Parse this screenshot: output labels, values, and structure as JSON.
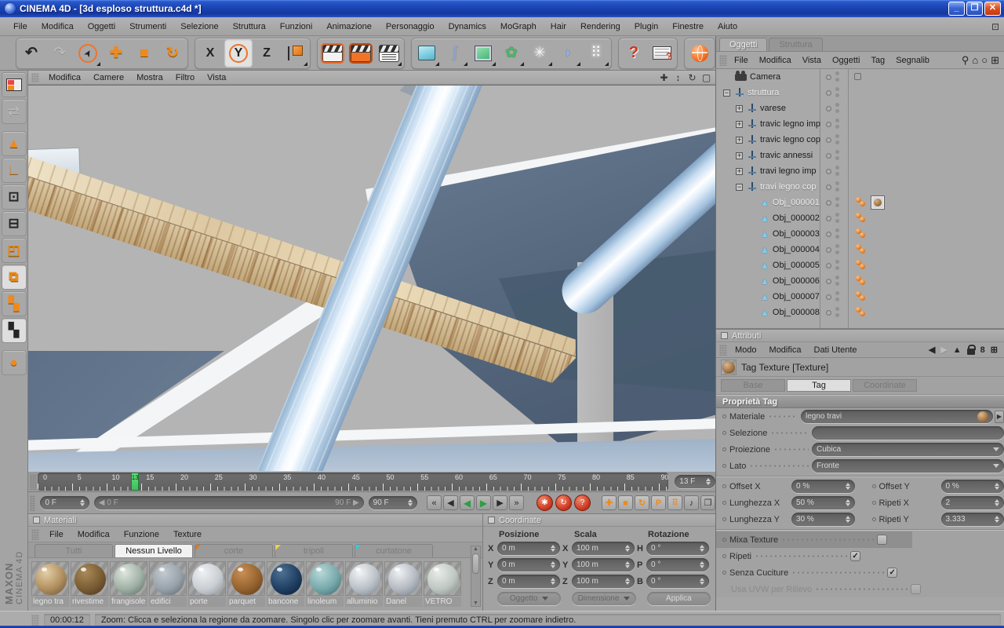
{
  "window": {
    "title": "CINEMA 4D - [3d esploso struttura.c4d *]",
    "controls": [
      {
        "name": "minimize-button",
        "glyph": "_"
      },
      {
        "name": "restore-button",
        "glyph": "❐"
      },
      {
        "name": "close-button",
        "glyph": "✕"
      }
    ]
  },
  "menu_bar": {
    "items": [
      "File",
      "Modifica",
      "Oggetti",
      "Strumenti",
      "Selezione",
      "Struttura",
      "Funzioni",
      "Animazione",
      "Personaggio",
      "Dynamics",
      "MoGraph",
      "Hair",
      "Rendering",
      "Plugin",
      "Finestre",
      "Aiuto"
    ],
    "right_icon": "⊡"
  },
  "toolbar": {
    "groups": [
      [
        {
          "name": "undo-icon",
          "glyph": "↶",
          "cls": "g-dk"
        },
        {
          "name": "redo-icon",
          "glyph": "↷",
          "cls": "g-dis"
        },
        {
          "name": "live-selection-icon",
          "cls": "fly",
          "special": "sel"
        },
        {
          "name": "move-icon",
          "glyph": "✚",
          "cls": "g-or"
        },
        {
          "name": "scale-icon",
          "glyph": "■",
          "cls": "g-or"
        },
        {
          "name": "rotate-icon",
          "glyph": "↻",
          "cls": "g-or"
        }
      ],
      [
        {
          "name": "x-axis-button",
          "glyph": "X",
          "special": "axis"
        },
        {
          "name": "y-axis-button",
          "glyph": "Y",
          "special": "axis-active"
        },
        {
          "name": "z-axis-button",
          "glyph": "Z",
          "special": "axis"
        },
        {
          "name": "coord-system-icon",
          "special": "coordsys",
          "cls": "fly"
        }
      ],
      [
        {
          "name": "render-view-icon",
          "special": "clap clap-active"
        },
        {
          "name": "render-picture-viewer-icon",
          "special": "clap clap-orange"
        },
        {
          "name": "render-settings-icon",
          "special": "clap clap-settings",
          "cls": "fly"
        }
      ],
      [
        {
          "name": "primitive-cube-icon",
          "special": "cube",
          "cls": "fly"
        },
        {
          "name": "spline-icon",
          "glyph": "ʃ",
          "cls": "g-blu fly"
        },
        {
          "name": "hypernurbs-icon",
          "special": "hnurbs",
          "cls": "fly"
        },
        {
          "name": "array-icon",
          "glyph": "✿",
          "cls": "g-grn fly"
        },
        {
          "name": "deformer-icon",
          "glyph": "✳",
          "cls": "g-wht fly"
        },
        {
          "name": "environment-icon",
          "glyph": "◗",
          "cls": "g-blu fly"
        },
        {
          "name": "particles-icon",
          "glyph": "⠿",
          "cls": "g-wht fly"
        }
      ],
      [
        {
          "name": "help-icon",
          "glyph": "?",
          "special": "help"
        },
        {
          "name": "commander-icon",
          "special": "cmdr"
        }
      ],
      [
        {
          "name": "browser-icon",
          "special": "globe"
        }
      ]
    ]
  },
  "left_toolbar": {
    "icons": [
      {
        "name": "layout-icon",
        "special": "layout"
      },
      {
        "name": "world-coords-icon",
        "glyph": "⇄",
        "cls": "g-dis"
      },
      {
        "name": "make-editable-icon",
        "glyph": "▲",
        "cls": "g-or"
      },
      {
        "name": "object-axis-icon",
        "glyph": "∟",
        "cls": "g-or"
      },
      {
        "name": "points-mode-icon",
        "glyph": "⊡",
        "cls": "g-dk"
      },
      {
        "name": "edges-mode-icon",
        "glyph": "⊟",
        "cls": "g-dk"
      },
      {
        "name": "polygons-mode-icon",
        "glyph": "◰",
        "cls": "g-or"
      },
      {
        "name": "model-mode-icon",
        "glyph": "⧉",
        "cls": "g-or",
        "active": true
      },
      {
        "name": "texture-mode-icon",
        "glyph": "▚",
        "cls": "g-or"
      },
      {
        "name": "texture-axis-mode-icon",
        "glyph": "▚",
        "cls": "g-dk",
        "active": true
      },
      {
        "name": "primitives-icon",
        "glyph": "●",
        "cls": "g-or"
      }
    ]
  },
  "branding": {
    "maxon": "MAXON",
    "product": "CINEMA 4D"
  },
  "viewport": {
    "menu": [
      "Modifica",
      "Camere",
      "Mostra",
      "Filtro",
      "Vista"
    ],
    "nav_icons": [
      {
        "name": "pan-view-icon",
        "glyph": "✚"
      },
      {
        "name": "zoom-view-icon",
        "glyph": "↕"
      },
      {
        "name": "rotate-view-icon",
        "glyph": "↻"
      },
      {
        "name": "maximize-view-icon",
        "glyph": "▢"
      }
    ]
  },
  "timeline": {
    "tick_start": 0,
    "tick_end": 90,
    "tick_step": 5,
    "current_frame": 13,
    "frame_spinner": "13 F",
    "start_spinner": "0 F",
    "end_spinner": "90 F",
    "range_start_label": "0 F",
    "range_end_label": "90 F",
    "playback": [
      {
        "name": "goto-start-button",
        "glyph": "«",
        "cls": ""
      },
      {
        "name": "prev-key-button",
        "glyph": "◀",
        "cls": ""
      },
      {
        "name": "play-backward-button",
        "glyph": "◀",
        "cls": "green"
      },
      {
        "name": "play-forward-button",
        "glyph": "▶",
        "cls": "green"
      },
      {
        "name": "next-key-button",
        "glyph": "▶",
        "cls": ""
      },
      {
        "name": "goto-end-button",
        "glyph": "»",
        "cls": ""
      }
    ],
    "record": [
      {
        "name": "record-keyframe-button",
        "glyph": "✱"
      },
      {
        "name": "autokey-button",
        "glyph": "↻"
      },
      {
        "name": "record-options-button",
        "glyph": "?"
      }
    ],
    "key_toggles": [
      {
        "name": "key-position-toggle",
        "glyph": "✚",
        "cls": "keytog"
      },
      {
        "name": "key-scale-toggle",
        "glyph": "■",
        "cls": "keytog"
      },
      {
        "name": "key-rotation-toggle",
        "glyph": "↻",
        "cls": "keytog"
      },
      {
        "name": "key-parameter-toggle",
        "glyph": "P",
        "cls": "keytog"
      },
      {
        "name": "key-pla-toggle",
        "glyph": "⠿",
        "cls": "keytog"
      },
      {
        "name": "sound-toggle",
        "glyph": "♪",
        "cls": "dkk"
      },
      {
        "name": "timeline-layout-toggle",
        "glyph": "❐",
        "cls": "dkk"
      }
    ]
  },
  "materials": {
    "title": "Materiali",
    "menu": [
      "File",
      "Modifica",
      "Funzione",
      "Texture"
    ],
    "tabs": [
      {
        "label": "Tutti",
        "active": false,
        "corner": null
      },
      {
        "label": "Nessun Livello",
        "active": true,
        "corner": null
      },
      {
        "label": "corte",
        "active": false,
        "corner": "#e07820"
      },
      {
        "label": "tripoli",
        "active": false,
        "corner": "#e8d44c"
      },
      {
        "label": "curtatone",
        "active": false,
        "corner": "#39c8dc"
      }
    ],
    "items": [
      {
        "name": "legno tra",
        "c1": "#e3cfa8",
        "c2": "#b08f5f",
        "c3": "#6f5636"
      },
      {
        "name": "rivestime",
        "c1": "#a98a58",
        "c2": "#7a5c34",
        "c3": "#4a3620"
      },
      {
        "name": "frangisole",
        "c1": "#dfe6df",
        "c2": "#9fb0a4",
        "c3": "#5d6e66"
      },
      {
        "name": "edifici",
        "c1": "#c3cad0",
        "c2": "#98a2aa",
        "c3": "#5f686f"
      },
      {
        "name": "porte",
        "c1": "#eef1f3",
        "c2": "#c9ced3",
        "c3": "#8e959b"
      },
      {
        "name": "parquet",
        "c1": "#c89055",
        "c2": "#96622f",
        "c3": "#5c3c1c"
      },
      {
        "name": "bancone",
        "c1": "#4e7193",
        "c2": "#1f3f63",
        "c3": "#0e2036"
      },
      {
        "name": "linoleum",
        "c1": "#b9d8d8",
        "c2": "#76a9ab",
        "c3": "#3f6a6c"
      },
      {
        "name": "alluminio",
        "c1": "#f2f4f6",
        "c2": "#b9c0c7",
        "c3": "#7c848c"
      },
      {
        "name": "Danel",
        "c1": "#eef0f3",
        "c2": "#b4bac2",
        "c3": "#767e88"
      },
      {
        "name": "VETRO",
        "c1": "#e9ece9",
        "c2": "#bec7c2",
        "c3": "#828c88"
      }
    ]
  },
  "coordinates": {
    "title": "Coordinate",
    "columns": [
      "Posizione",
      "Scala",
      "Rotazione"
    ],
    "rows": [
      {
        "pos_axis": "X",
        "pos": "0 m",
        "scale_axis": "X",
        "scale": "100 m",
        "rot_axis": "H",
        "rot": "0 °"
      },
      {
        "pos_axis": "Y",
        "pos": "0 m",
        "scale_axis": "Y",
        "scale": "100 m",
        "rot_axis": "P",
        "rot": "0 °"
      },
      {
        "pos_axis": "Z",
        "pos": "0 m",
        "scale_axis": "Z",
        "scale": "100 m",
        "rot_axis": "B",
        "rot": "0 °"
      }
    ],
    "buttons": [
      {
        "name": "oggetto-dropdown",
        "label": "Oggetto",
        "dropdown": true
      },
      {
        "name": "dimensione-dropdown",
        "label": "Dimensione",
        "dropdown": true
      },
      {
        "name": "applica-button",
        "label": "Applica",
        "dropdown": false
      }
    ]
  },
  "object_manager": {
    "tabs": [
      {
        "label": "Oggetti",
        "active": true
      },
      {
        "label": "Struttura",
        "active": false
      }
    ],
    "menu": [
      "File",
      "Modifica",
      "Vista",
      "Oggetti",
      "Tag",
      "Segnalib"
    ],
    "icons": [
      {
        "name": "search-icon",
        "glyph": "⚲"
      },
      {
        "name": "home-icon",
        "glyph": "⌂"
      },
      {
        "name": "filter-icon",
        "glyph": "○"
      },
      {
        "name": "add-panel-icon",
        "glyph": "⊞"
      }
    ],
    "tree": [
      {
        "label": "Camera",
        "type": "cam",
        "depth": 0,
        "expand": null,
        "dim": false,
        "tags": false,
        "tex": false,
        "target": true
      },
      {
        "label": "struttura",
        "type": "null",
        "depth": 0,
        "expand": "-",
        "dim": true,
        "tags": false,
        "tex": false,
        "target": false
      },
      {
        "label": "varese",
        "type": "null",
        "depth": 1,
        "expand": "+",
        "dim": false,
        "tags": false,
        "tex": false,
        "target": false
      },
      {
        "label": "travic legno imp",
        "type": "null",
        "depth": 1,
        "expand": "+",
        "dim": false,
        "tags": false,
        "tex": false,
        "target": false
      },
      {
        "label": "travic legno cop",
        "type": "null",
        "depth": 1,
        "expand": "+",
        "dim": false,
        "tags": false,
        "tex": false,
        "target": false
      },
      {
        "label": "travic annessi",
        "type": "null",
        "depth": 1,
        "expand": "+",
        "dim": false,
        "tags": false,
        "tex": false,
        "target": false
      },
      {
        "label": "travi legno imp",
        "type": "null",
        "depth": 1,
        "expand": "+",
        "dim": false,
        "tags": false,
        "tex": false,
        "target": false
      },
      {
        "label": "travi legno cop",
        "type": "null",
        "depth": 1,
        "expand": "-",
        "dim": true,
        "tags": false,
        "tex": false,
        "target": false
      },
      {
        "label": "Obj_000001",
        "type": "poly",
        "depth": 2,
        "expand": null,
        "dim": true,
        "tags": true,
        "tex": true,
        "target": false
      },
      {
        "label": "Obj_000002",
        "type": "poly",
        "depth": 2,
        "expand": null,
        "dim": false,
        "tags": true,
        "tex": false,
        "target": false
      },
      {
        "label": "Obj_000003",
        "type": "poly",
        "depth": 2,
        "expand": null,
        "dim": false,
        "tags": true,
        "tex": false,
        "target": false
      },
      {
        "label": "Obj_000004",
        "type": "poly",
        "depth": 2,
        "expand": null,
        "dim": false,
        "tags": true,
        "tex": false,
        "target": false
      },
      {
        "label": "Obj_000005",
        "type": "poly",
        "depth": 2,
        "expand": null,
        "dim": false,
        "tags": true,
        "tex": false,
        "target": false
      },
      {
        "label": "Obj_000006",
        "type": "poly",
        "depth": 2,
        "expand": null,
        "dim": false,
        "tags": true,
        "tex": false,
        "target": false
      },
      {
        "label": "Obj_000007",
        "type": "poly",
        "depth": 2,
        "expand": null,
        "dim": false,
        "tags": true,
        "tex": false,
        "target": false
      },
      {
        "label": "Obj_000008",
        "type": "poly",
        "depth": 2,
        "expand": null,
        "dim": false,
        "tags": true,
        "tex": false,
        "target": false
      }
    ]
  },
  "attributes": {
    "title": "Attributi",
    "menu": [
      "Modo",
      "Modifica",
      "Dati Utente"
    ],
    "header_icons": [
      {
        "name": "back-icon",
        "glyph": "◀",
        "cls": "g-dk"
      },
      {
        "name": "forward-icon",
        "glyph": "▶",
        "cls": "g-dis"
      },
      {
        "name": "up-icon",
        "glyph": "▲",
        "cls": "g-dk"
      },
      {
        "name": "lock-icon",
        "glyph": "",
        "cls": "lock"
      },
      {
        "name": "mode-icon",
        "glyph": "8",
        "cls": "g-dk"
      },
      {
        "name": "add-panel-icon",
        "glyph": "⊞",
        "cls": "g-dk"
      }
    ],
    "object_label": "Tag Texture [Texture]",
    "tabs": [
      {
        "label": "Base",
        "active": false
      },
      {
        "label": "Tag",
        "active": true
      },
      {
        "label": "Coordinate",
        "active": false
      }
    ],
    "section": "Proprietà Tag",
    "fields": [
      {
        "name": "materiale-field",
        "label": "Materiale",
        "value": "legno travi",
        "type": "material"
      },
      {
        "name": "selezione-field",
        "label": "Selezione",
        "value": "",
        "type": "text"
      },
      {
        "name": "proiezione-dropdown",
        "label": "Proiezione",
        "value": "Cubica",
        "type": "dropdown"
      },
      {
        "name": "lato-dropdown",
        "label": "Lato",
        "value": "Fronte",
        "type": "dropdown"
      }
    ],
    "pairs": [
      [
        {
          "name": "offset-x-field",
          "label": "Offset X",
          "value": "0 %"
        },
        {
          "name": "offset-y-field",
          "label": "Offset Y",
          "value": "0 %"
        }
      ],
      [
        {
          "name": "lunghezza-x-field",
          "label": "Lunghezza X",
          "value": "50 %"
        },
        {
          "name": "ripeti-x-field",
          "label": "Ripeti X",
          "value": "2"
        }
      ],
      [
        {
          "name": "lunghezza-y-field",
          "label": "Lunghezza Y",
          "value": "30 %"
        },
        {
          "name": "ripeti-y-field",
          "label": "Ripeti Y",
          "value": "3.333"
        }
      ]
    ],
    "checks": [
      {
        "name": "mixa-texture-checkbox",
        "label": "Mixa Texture",
        "checked": false,
        "highlight": true,
        "disabled": false
      },
      {
        "name": "ripeti-checkbox",
        "label": "Ripeti",
        "checked": true,
        "highlight": false,
        "disabled": false
      },
      {
        "name": "senza-cuciture-checkbox",
        "label": "Senza Cuciture",
        "checked": true,
        "highlight": false,
        "disabled": false
      },
      {
        "name": "usa-uvw-checkbox",
        "label": "Usa UVW per Rilievo",
        "checked": false,
        "highlight": false,
        "disabled": true
      }
    ]
  },
  "status_bar": {
    "time": "00:00:12",
    "message": "Zoom: Clicca e seleziona la regione da zoomare. Singolo clic per zoomare avanti. Tieni premuto CTRL per zoomare indietro."
  }
}
